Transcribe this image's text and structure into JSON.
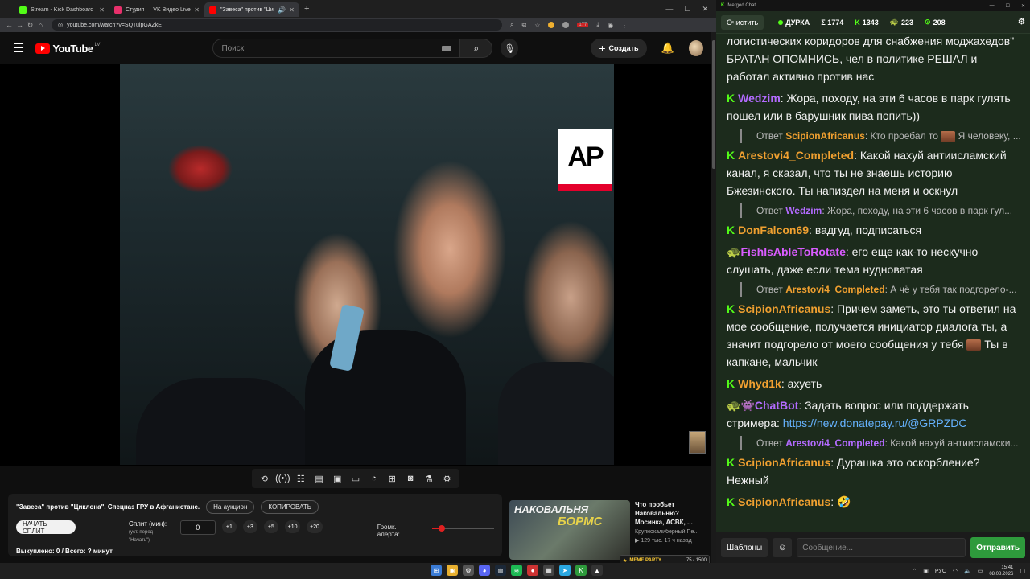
{
  "browser": {
    "tabs": [
      {
        "label": "Stream - Kick Dashboard",
        "color": "#53fc18"
      },
      {
        "label": "Студия — VK Видео Live",
        "color": "#e8306b"
      },
      {
        "label": "\"Завеса\" против \"Циклона\"",
        "color": "#ff0000"
      }
    ],
    "new_tab": "+",
    "url": "youtube.com/watch?v=SQTulpGAZkE",
    "ext_badge": "177"
  },
  "youtube": {
    "logo_text": "YouTube",
    "country": "LV",
    "search_placeholder": "Поиск",
    "create_label": "Создать"
  },
  "video": {
    "ap_text": "AP"
  },
  "panel": {
    "title": "\"Завеса\" против \"Циклона\". Спецназ ГРУ в Афганистане.",
    "auction_btn": "На аукцион",
    "copy_btn": "КОПИРОВАТЬ",
    "start_split_btn": "НАЧАТЬ СПЛИТ",
    "split_label": "Сплит (мин):",
    "split_sub": "(уст. перед \"Начать\")",
    "split_value": "0",
    "increments": [
      "+1",
      "+3",
      "+5",
      "+10",
      "+20"
    ],
    "volume_label": "Громк. алерта:",
    "volume_level": 0.15,
    "status": "Выкуплено: 0 / Всего: ? минут"
  },
  "recommended": {
    "thumb_text1": "НАКОВАЛЬНЯ",
    "thumb_text2": "БОРМС",
    "title": "Что пробьет Наковальню? Мосинка, АСВК, ...",
    "channel": "Крупнокалиберный Пе...",
    "meta": "▶ 129 тыс.   17 ч назад"
  },
  "overlay": {
    "meme_party": "MEME PARTY",
    "meme_count": "75 / 1500"
  },
  "taskbar": {
    "lang": "РУС",
    "time": "15:41",
    "date": "08.08.2026"
  },
  "chat": {
    "window_title": "Merged Chat",
    "clear_btn": "Очистить",
    "streamer": "ДУРКА",
    "total": "Σ 1774",
    "kick_count": "1343",
    "other_count": "223",
    "third_count": "208",
    "messages": [
      {
        "type": "text",
        "text": "логистических коридоров для снабжения моджахедов\" БРАТАН ОПОМНИСЬ, чел в политике РЕШАЛ и работал активно против нас"
      },
      {
        "type": "msg",
        "user": "Wedzim",
        "color": "#b36bff",
        "text": "Жора, походу, на эти 6 часов в парк гулять пошел или в барушник пива попить))"
      },
      {
        "type": "reply",
        "prefix": "Ответ",
        "user": "ScipionAfricanus",
        "color": "#f0a030",
        "text": "Кто проебал то",
        "tail": "Я человеку, ..."
      },
      {
        "type": "msg",
        "user": "Arestovi4_Completed",
        "color": "#f0a030",
        "text": "Какой нахуй антиисламский канал, я сказал, что ты не знаешь историю Бжезинского. Ты напиздел на меня и оскнул"
      },
      {
        "type": "reply",
        "prefix": "Ответ",
        "user": "Wedzim",
        "color": "#b36bff",
        "text": "Жора, походу, на эти 6 часов в парк гул..."
      },
      {
        "type": "msg",
        "user": "DonFalcon69",
        "color": "#f0a030",
        "text": "вадгуд, подписаться"
      },
      {
        "type": "msg2",
        "user": "FishIsAbleToRotate",
        "color": "#d95cff",
        "text": "его еще как-то нескучно слушать, даже если тема нудноватая"
      },
      {
        "type": "reply",
        "prefix": "Ответ",
        "user": "Arestovi4_Completed",
        "color": "#f0a030",
        "text": "А чё у тебя так подгорело-..."
      },
      {
        "type": "msg",
        "user": "ScipionAfricanus",
        "color": "#f0a030",
        "text": "Причем заметь, это ты ответил на мое сообщение, получается инициатор диалога ты, а значит подгорело от моего сообщения у тебя",
        "tail": "Ты в капкане, мальчик"
      },
      {
        "type": "msg",
        "user": "Whyd1k",
        "color": "#f0a030",
        "text": "ахуеть"
      },
      {
        "type": "bot",
        "user": "ChatBot",
        "color": "#b36bff",
        "text": "Задать вопрос или поддержать стримера:",
        "link": "https://new.donatepay.ru/@GRPZDC"
      },
      {
        "type": "reply",
        "prefix": "Ответ",
        "user": "Arestovi4_Completed",
        "color": "#b36bff",
        "text": "Какой нахуй антиисламски..."
      },
      {
        "type": "msg",
        "user": "ScipionAfricanus",
        "color": "#f0a030",
        "text": "Дурашка это оскорбление? Нежный"
      },
      {
        "type": "msg",
        "user": "ScipionAfricanus",
        "color": "#f0a030",
        "text": "🤣"
      }
    ],
    "templates_btn": "Шаблоны",
    "input_placeholder": "Сообщение...",
    "send_btn": "Отправить"
  },
  "colors": {
    "kick_green": "#53fc18",
    "chat_bg": "#1c2b1c",
    "send_green": "#2e9a3c",
    "yt_red": "#ff0000"
  }
}
